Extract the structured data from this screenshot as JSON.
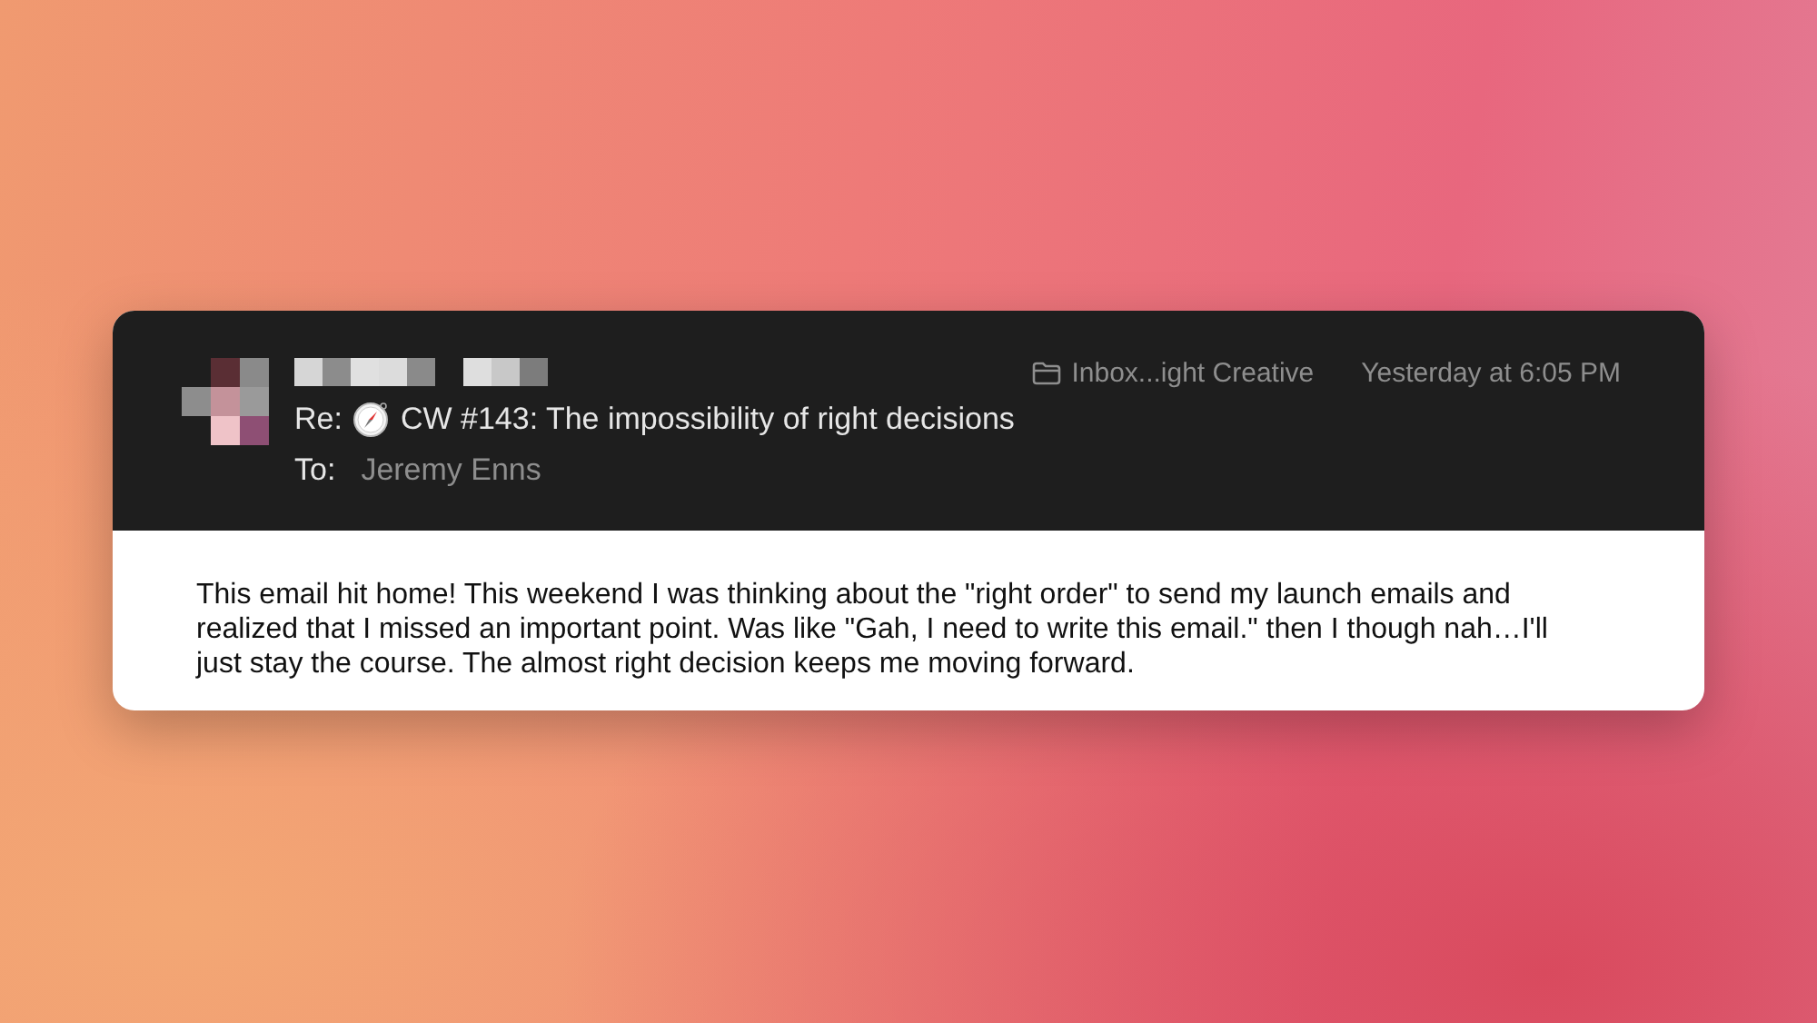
{
  "email": {
    "subject_prefix": "Re:",
    "subject": "CW #143: The impossibility of right decisions",
    "to_label": "To:",
    "to": "Jeremy Enns",
    "mailbox": "Inbox...ight Creative",
    "date": "Yesterday at 6:05 PM"
  },
  "body": "This email hit home! This weekend I was thinking about the \"right order\" to send my launch emails and realized that I missed an important point. Was like \"Gah, I need to write this email.\" then I though nah…I'll just stay the course. The almost right decision keeps me moving forward."
}
